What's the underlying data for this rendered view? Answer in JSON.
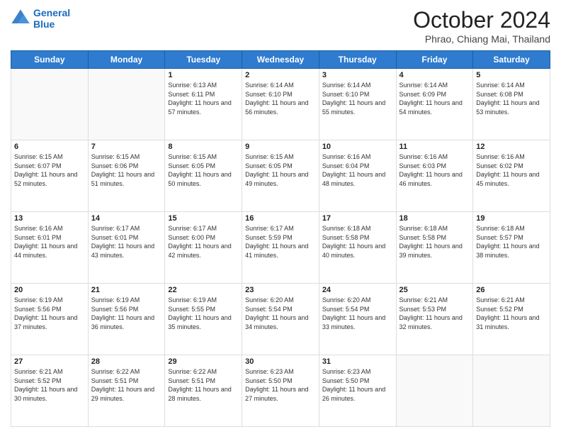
{
  "header": {
    "logo_line1": "General",
    "logo_line2": "Blue",
    "month_title": "October 2024",
    "location": "Phrao, Chiang Mai, Thailand"
  },
  "weekdays": [
    "Sunday",
    "Monday",
    "Tuesday",
    "Wednesday",
    "Thursday",
    "Friday",
    "Saturday"
  ],
  "weeks": [
    [
      {
        "day": "",
        "sunrise": "",
        "sunset": "",
        "daylight": ""
      },
      {
        "day": "",
        "sunrise": "",
        "sunset": "",
        "daylight": ""
      },
      {
        "day": "1",
        "sunrise": "Sunrise: 6:13 AM",
        "sunset": "Sunset: 6:11 PM",
        "daylight": "Daylight: 11 hours and 57 minutes."
      },
      {
        "day": "2",
        "sunrise": "Sunrise: 6:14 AM",
        "sunset": "Sunset: 6:10 PM",
        "daylight": "Daylight: 11 hours and 56 minutes."
      },
      {
        "day": "3",
        "sunrise": "Sunrise: 6:14 AM",
        "sunset": "Sunset: 6:10 PM",
        "daylight": "Daylight: 11 hours and 55 minutes."
      },
      {
        "day": "4",
        "sunrise": "Sunrise: 6:14 AM",
        "sunset": "Sunset: 6:09 PM",
        "daylight": "Daylight: 11 hours and 54 minutes."
      },
      {
        "day": "5",
        "sunrise": "Sunrise: 6:14 AM",
        "sunset": "Sunset: 6:08 PM",
        "daylight": "Daylight: 11 hours and 53 minutes."
      }
    ],
    [
      {
        "day": "6",
        "sunrise": "Sunrise: 6:15 AM",
        "sunset": "Sunset: 6:07 PM",
        "daylight": "Daylight: 11 hours and 52 minutes."
      },
      {
        "day": "7",
        "sunrise": "Sunrise: 6:15 AM",
        "sunset": "Sunset: 6:06 PM",
        "daylight": "Daylight: 11 hours and 51 minutes."
      },
      {
        "day": "8",
        "sunrise": "Sunrise: 6:15 AM",
        "sunset": "Sunset: 6:05 PM",
        "daylight": "Daylight: 11 hours and 50 minutes."
      },
      {
        "day": "9",
        "sunrise": "Sunrise: 6:15 AM",
        "sunset": "Sunset: 6:05 PM",
        "daylight": "Daylight: 11 hours and 49 minutes."
      },
      {
        "day": "10",
        "sunrise": "Sunrise: 6:16 AM",
        "sunset": "Sunset: 6:04 PM",
        "daylight": "Daylight: 11 hours and 48 minutes."
      },
      {
        "day": "11",
        "sunrise": "Sunrise: 6:16 AM",
        "sunset": "Sunset: 6:03 PM",
        "daylight": "Daylight: 11 hours and 46 minutes."
      },
      {
        "day": "12",
        "sunrise": "Sunrise: 6:16 AM",
        "sunset": "Sunset: 6:02 PM",
        "daylight": "Daylight: 11 hours and 45 minutes."
      }
    ],
    [
      {
        "day": "13",
        "sunrise": "Sunrise: 6:16 AM",
        "sunset": "Sunset: 6:01 PM",
        "daylight": "Daylight: 11 hours and 44 minutes."
      },
      {
        "day": "14",
        "sunrise": "Sunrise: 6:17 AM",
        "sunset": "Sunset: 6:01 PM",
        "daylight": "Daylight: 11 hours and 43 minutes."
      },
      {
        "day": "15",
        "sunrise": "Sunrise: 6:17 AM",
        "sunset": "Sunset: 6:00 PM",
        "daylight": "Daylight: 11 hours and 42 minutes."
      },
      {
        "day": "16",
        "sunrise": "Sunrise: 6:17 AM",
        "sunset": "Sunset: 5:59 PM",
        "daylight": "Daylight: 11 hours and 41 minutes."
      },
      {
        "day": "17",
        "sunrise": "Sunrise: 6:18 AM",
        "sunset": "Sunset: 5:58 PM",
        "daylight": "Daylight: 11 hours and 40 minutes."
      },
      {
        "day": "18",
        "sunrise": "Sunrise: 6:18 AM",
        "sunset": "Sunset: 5:58 PM",
        "daylight": "Daylight: 11 hours and 39 minutes."
      },
      {
        "day": "19",
        "sunrise": "Sunrise: 6:18 AM",
        "sunset": "Sunset: 5:57 PM",
        "daylight": "Daylight: 11 hours and 38 minutes."
      }
    ],
    [
      {
        "day": "20",
        "sunrise": "Sunrise: 6:19 AM",
        "sunset": "Sunset: 5:56 PM",
        "daylight": "Daylight: 11 hours and 37 minutes."
      },
      {
        "day": "21",
        "sunrise": "Sunrise: 6:19 AM",
        "sunset": "Sunset: 5:56 PM",
        "daylight": "Daylight: 11 hours and 36 minutes."
      },
      {
        "day": "22",
        "sunrise": "Sunrise: 6:19 AM",
        "sunset": "Sunset: 5:55 PM",
        "daylight": "Daylight: 11 hours and 35 minutes."
      },
      {
        "day": "23",
        "sunrise": "Sunrise: 6:20 AM",
        "sunset": "Sunset: 5:54 PM",
        "daylight": "Daylight: 11 hours and 34 minutes."
      },
      {
        "day": "24",
        "sunrise": "Sunrise: 6:20 AM",
        "sunset": "Sunset: 5:54 PM",
        "daylight": "Daylight: 11 hours and 33 minutes."
      },
      {
        "day": "25",
        "sunrise": "Sunrise: 6:21 AM",
        "sunset": "Sunset: 5:53 PM",
        "daylight": "Daylight: 11 hours and 32 minutes."
      },
      {
        "day": "26",
        "sunrise": "Sunrise: 6:21 AM",
        "sunset": "Sunset: 5:52 PM",
        "daylight": "Daylight: 11 hours and 31 minutes."
      }
    ],
    [
      {
        "day": "27",
        "sunrise": "Sunrise: 6:21 AM",
        "sunset": "Sunset: 5:52 PM",
        "daylight": "Daylight: 11 hours and 30 minutes."
      },
      {
        "day": "28",
        "sunrise": "Sunrise: 6:22 AM",
        "sunset": "Sunset: 5:51 PM",
        "daylight": "Daylight: 11 hours and 29 minutes."
      },
      {
        "day": "29",
        "sunrise": "Sunrise: 6:22 AM",
        "sunset": "Sunset: 5:51 PM",
        "daylight": "Daylight: 11 hours and 28 minutes."
      },
      {
        "day": "30",
        "sunrise": "Sunrise: 6:23 AM",
        "sunset": "Sunset: 5:50 PM",
        "daylight": "Daylight: 11 hours and 27 minutes."
      },
      {
        "day": "31",
        "sunrise": "Sunrise: 6:23 AM",
        "sunset": "Sunset: 5:50 PM",
        "daylight": "Daylight: 11 hours and 26 minutes."
      },
      {
        "day": "",
        "sunrise": "",
        "sunset": "",
        "daylight": ""
      },
      {
        "day": "",
        "sunrise": "",
        "sunset": "",
        "daylight": ""
      }
    ]
  ]
}
